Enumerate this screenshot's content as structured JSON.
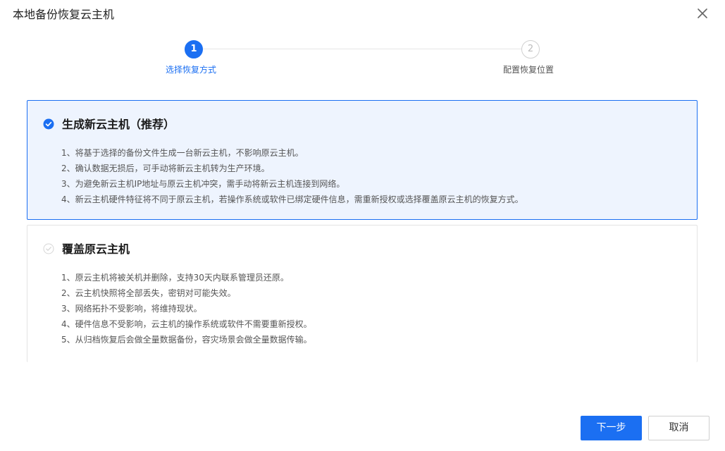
{
  "dialog": {
    "title": "本地备份恢复云主机"
  },
  "stepper": {
    "steps": [
      {
        "number": "1",
        "label": "选择恢复方式",
        "state": "active"
      },
      {
        "number": "2",
        "label": "配置恢复位置",
        "state": "pending"
      }
    ]
  },
  "options": [
    {
      "title": "生成新云主机（推荐）",
      "selected": true,
      "items": [
        "1、将基于选择的备份文件生成一台新云主机，不影响原云主机。",
        "2、确认数据无损后，可手动将新云主机转为生产环境。",
        "3、为避免新云主机IP地址与原云主机冲突，需手动将新云主机连接到网络。",
        "4、新云主机硬件特征将不同于原云主机，若操作系统或软件已绑定硬件信息，需重新授权或选择覆盖原云主机的恢复方式。"
      ]
    },
    {
      "title": "覆盖原云主机",
      "selected": false,
      "items": [
        "1、原云主机将被关机并删除，支持30天内联系管理员还原。",
        "2、云主机快照将全部丢失，密钥对可能失效。",
        "3、网络拓扑不受影响，将维持现状。",
        "4、硬件信息不受影响，云主机的操作系统或软件不需要重新授权。",
        "5、从归档恢复后会做全量数据备份，容灾场景会做全量数据传输。"
      ]
    }
  ],
  "footer": {
    "next_label": "下一步",
    "cancel_label": "取消"
  },
  "colors": {
    "accent": "#1b6ff2",
    "selected_bg": "#eef4fe"
  },
  "icons": {
    "close": "close-icon",
    "selected": "check-circle-icon",
    "unselected": "check-circle-outline-icon"
  }
}
